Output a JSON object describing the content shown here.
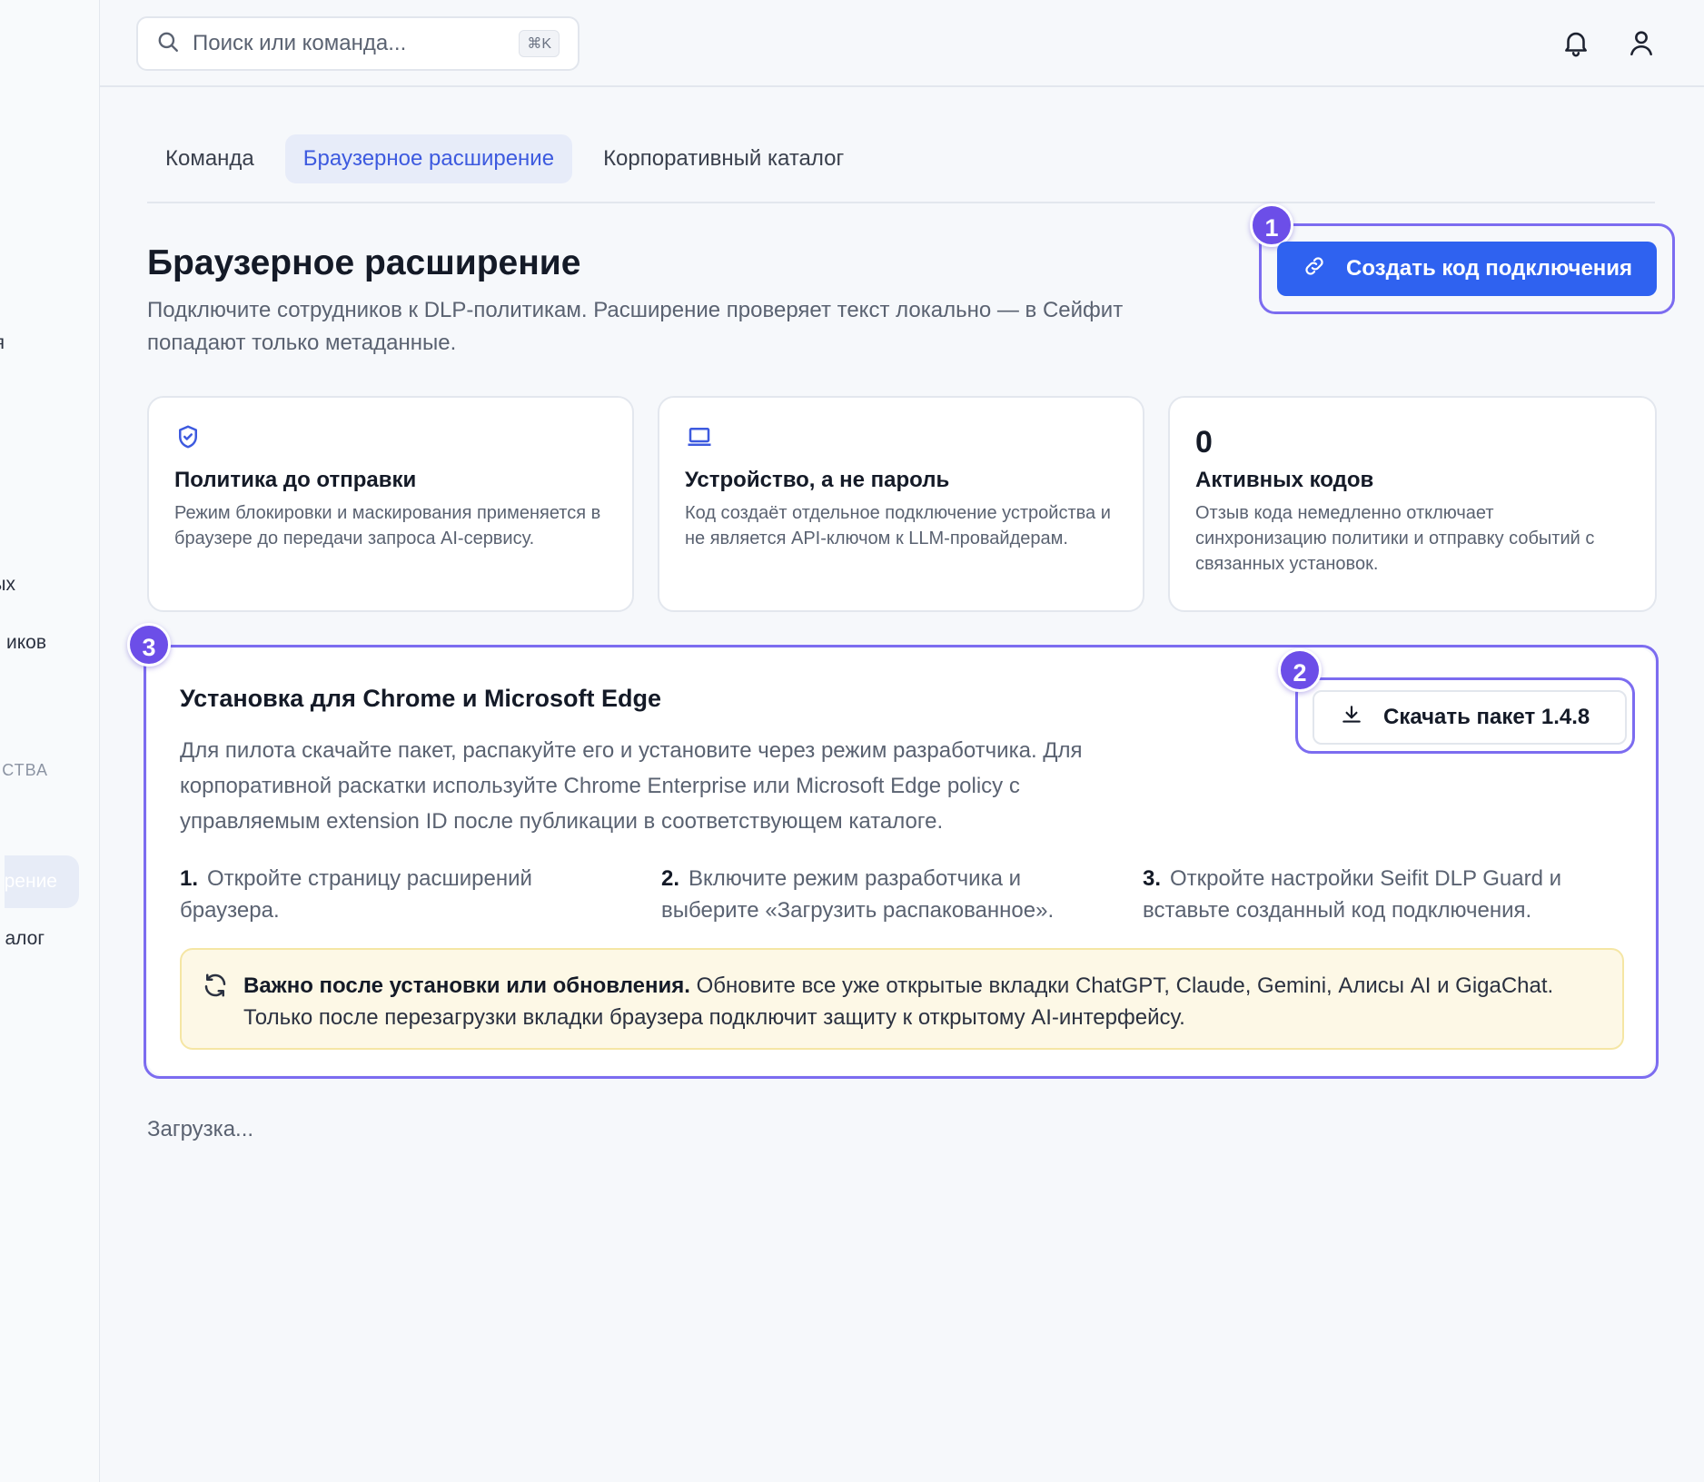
{
  "sidebar": {
    "fragments": [
      "я",
      "ых",
      "иков",
      "СТВА",
      "рение",
      "алог"
    ]
  },
  "topbar": {
    "search_placeholder": "Поиск или команда...",
    "search_shortcut": "⌘K",
    "icons": [
      "bell-icon",
      "user-icon"
    ]
  },
  "tabs": [
    {
      "label": "Команда"
    },
    {
      "label": "Браузерное расширение",
      "active": true
    },
    {
      "label": "Корпоративный каталог"
    }
  ],
  "page": {
    "title": "Браузерное расширение",
    "subtitle": "Подключите сотрудников к DLP-политикам. Расширение проверяет текст локально — в Сейфит попадают только метаданные.",
    "create_button_label": "Создать код подключения"
  },
  "cards": [
    {
      "icon": "shield-check-icon",
      "title": "Политика до отправки",
      "text": "Режим блокировки и маскирования применяется в браузере до передачи запроса AI-сервису."
    },
    {
      "icon": "laptop-icon",
      "title": "Устройство, а не пароль",
      "text": "Код создаёт отдельное подключение устройства и не является API-ключом к LLM-провайдерам."
    },
    {
      "count": "0",
      "title": "Активных кодов",
      "text": "Отзыв кода немедленно отключает синхронизацию политики и отправку событий с связанных установок."
    }
  ],
  "install": {
    "title": "Установка для Chrome и Microsoft Edge",
    "text": "Для пилота скачайте пакет, распакуйте его и установите через режим разработчика. Для корпоративной раскатки используйте Chrome Enterprise или Microsoft Edge policy с управляемым extension ID после публикации в соответствующем каталоге.",
    "download_label": "Скачать пакет 1.4.8",
    "steps": [
      {
        "num": "1.",
        "text": "Откройте страницу расширений браузера."
      },
      {
        "num": "2.",
        "text": "Включите режим разработчика и выберите «Загрузить распакованное»."
      },
      {
        "num": "3.",
        "text": "Откройте настройки Seifit DLP Guard и вставьте созданный код подключения."
      }
    ],
    "notice_bold": "Важно после установки или обновления.",
    "notice_text": " Обновите все уже открытые вкладки ChatGPT, Claude, Gemini, Алисы AI и GigaChat. Только после перезагрузки вкладки браузера подключит защиту к открытому AI-интерфейсу."
  },
  "callouts": [
    "1",
    "2",
    "3"
  ],
  "loading_text": "Загрузка...",
  "colors": {
    "accent": "#2f62f0",
    "callout": "#6c4ee8",
    "tab_active_bg": "#e7ecf9",
    "notice_bg": "#fdf8e6"
  }
}
